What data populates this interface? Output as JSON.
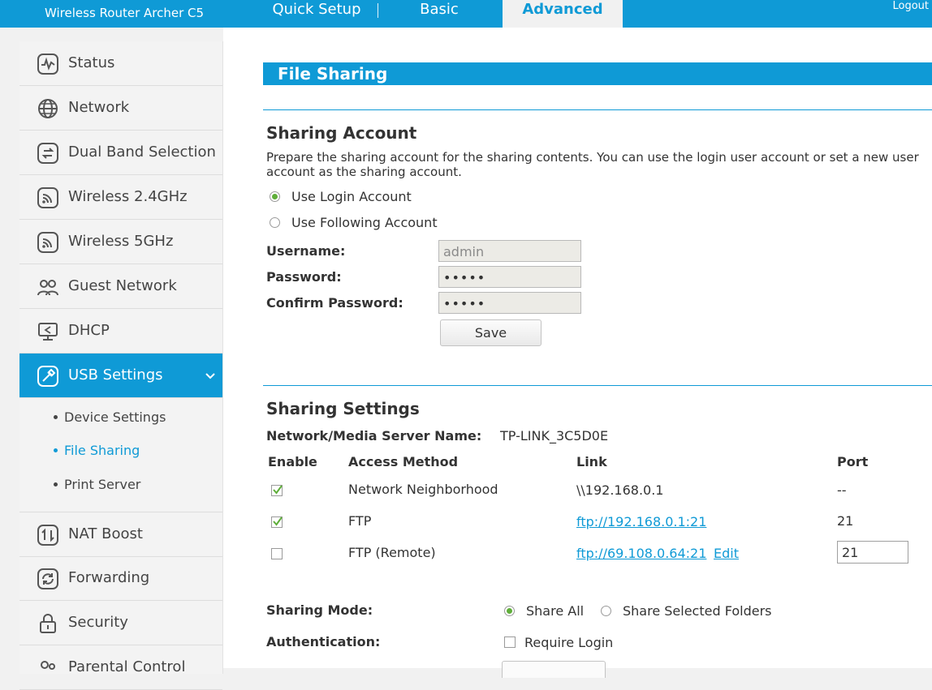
{
  "header": {
    "brand": "Wireless Router Archer C5",
    "tabs": [
      "Quick Setup",
      "Basic",
      "Advanced"
    ],
    "logout": "Logout"
  },
  "sidebar": {
    "items": [
      {
        "label": "Status",
        "icon": "pulse-icon"
      },
      {
        "label": "Network",
        "icon": "globe-icon"
      },
      {
        "label": "Dual Band Selection",
        "icon": "dual-band-icon"
      },
      {
        "label": "Wireless 2.4GHz",
        "icon": "wireless-icon"
      },
      {
        "label": "Wireless 5GHz",
        "icon": "wireless-icon"
      },
      {
        "label": "Guest Network",
        "icon": "guest-users-icon"
      },
      {
        "label": "DHCP",
        "icon": "monitor-share-icon"
      },
      {
        "label": "USB Settings",
        "icon": "usb-icon"
      },
      {
        "label": "NAT Boost",
        "icon": "nat-boost-icon"
      },
      {
        "label": "Forwarding",
        "icon": "forwarding-icon"
      },
      {
        "label": "Security",
        "icon": "lock-icon"
      },
      {
        "label": "Parental Control",
        "icon": "parental-icon"
      }
    ],
    "usb_sub": [
      "Device Settings",
      "File Sharing",
      "Print Server"
    ],
    "active_color": "#0f9ad6"
  },
  "page": {
    "title": "File Sharing",
    "account": {
      "title": "Sharing Account",
      "description": "Prepare the sharing account for the sharing contents. You can use the login user account or set a new user account as the sharing account.",
      "options": [
        "Use Login Account",
        "Use Following Account"
      ],
      "selected": "Use Login Account",
      "username_label": "Username:",
      "username_value": "admin",
      "password_label": "Password:",
      "password_value": "•••••",
      "confirm_label": "Confirm Password:",
      "confirm_value": "•••••",
      "save": "Save"
    },
    "settings": {
      "title": "Sharing Settings",
      "server_label": "Network/Media Server Name:",
      "server_value": "TP-LINK_3C5D0E",
      "headers": [
        "Enable",
        "Access Method",
        "Link",
        "Port"
      ],
      "rows": [
        {
          "enabled": true,
          "method": "Network Neighborhood",
          "link": "\\\\192.168.0.1",
          "port": "--"
        },
        {
          "enabled": true,
          "method": "FTP",
          "link": "ftp://192.168.0.1:21",
          "port": "21"
        },
        {
          "enabled": false,
          "method": "FTP (Remote)",
          "link": "ftp://69.108.0.64:21",
          "edit": "Edit",
          "port": "21"
        }
      ],
      "mode_label": "Sharing Mode:",
      "mode_options": [
        "Share All",
        "Share Selected Folders"
      ],
      "mode_selected": "Share All",
      "auth_label": "Authentication:",
      "auth_option": "Require Login",
      "auth_checked": false
    }
  }
}
